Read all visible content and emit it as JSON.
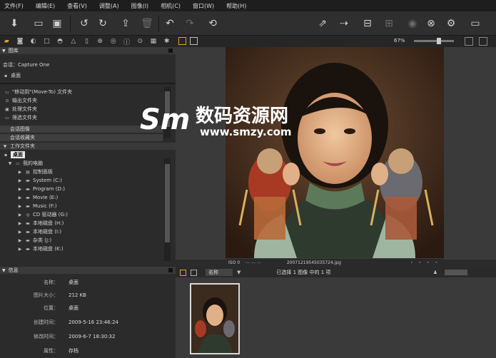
{
  "menubar": {
    "items": [
      "文件(F)",
      "编辑(E)",
      "查看(V)",
      "调整(A)",
      "图像(I)",
      "相机(C)",
      "窗口(W)",
      "帮助(H)"
    ]
  },
  "toolbar": {
    "zoom_label": "67%"
  },
  "library": {
    "header": "图库",
    "session_label": "会话：Capture One",
    "desktop_label": "桌面",
    "special_folders": [
      "\"移动到\"(Move-To) 文件夹",
      "输出文件夹",
      "处理文件夹",
      "筛选文件夹"
    ],
    "albums": [
      "会话图像",
      "会话收藏夹"
    ],
    "working_header": "工作文件夹",
    "current_folder": "桌面",
    "tree": [
      "我的电脑",
      "控制面板",
      "System (C:)",
      "Program (D:)",
      "Movie (E:)",
      "Music (F:)",
      "CD 驱动器 (G:)",
      "本地磁盘 (H:)",
      "本地磁盘 (I:)",
      "杂类 (J:)",
      "本地磁盘 (K:)"
    ]
  },
  "info": {
    "header": "信息",
    "rows": [
      {
        "label": "名称：",
        "value": "桌面"
      },
      {
        "label": "图片大小：",
        "value": "212 KB"
      },
      {
        "label": "位置：",
        "value": "桌面"
      },
      {
        "label": "创建时间：",
        "value": "2009-5-16 23:46:24"
      },
      {
        "label": "修改时间：",
        "value": "2009-6-7 18:30:32"
      },
      {
        "label": "属性：",
        "value": "存档"
      }
    ]
  },
  "viewer": {
    "iso_label": "ISO 0",
    "exif_placeholder": "— — —",
    "filename": "20071219545035724.jpg"
  },
  "browser": {
    "sort_label": "名称",
    "status": "已选择 1 图像 中的 1 项"
  },
  "watermark": {
    "title": "数码资源网",
    "url": "www.smzy.com"
  },
  "colors": {
    "accent": "#e0a030",
    "panel": "#2b2b2b",
    "header": "#3a3a3a"
  }
}
